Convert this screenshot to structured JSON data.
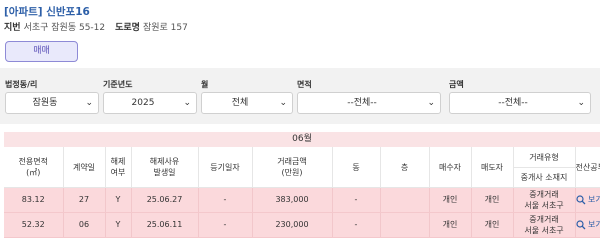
{
  "header": {
    "title": "[아파트] 신반포16",
    "jibun_label": "지번",
    "jibun_value": "서초구 잠원동 55-12",
    "road_label": "도로명",
    "road_value": "잠원로 157"
  },
  "trade_button": "매매",
  "filters": {
    "dong": {
      "label": "법정동/리",
      "value": "잠원동"
    },
    "year": {
      "label": "기준년도",
      "value": "2025"
    },
    "month": {
      "label": "월",
      "value": "전체"
    },
    "area": {
      "label": "면적",
      "value": "--전체--"
    },
    "amount": {
      "label": "금액",
      "value": "--전체--"
    }
  },
  "month_heading": "06월",
  "table": {
    "headers": {
      "area": "전용면적\n(㎡)",
      "contract_day": "계약일",
      "cancel_flag": "해제\n여부",
      "cancel_date": "해제사유\n발생일",
      "register_date": "등기일자",
      "price": "거래금액\n(만원)",
      "building": "동",
      "floor": "층",
      "buyer": "매수자",
      "seller": "매도자",
      "trade_type_top": "거래유형",
      "trade_type_bottom": "중개사 소재지",
      "public_doc": "전산공부"
    },
    "rows": [
      {
        "area": "83.12",
        "contract_day": "27",
        "cancel_flag": "Y",
        "cancel_date": "25.06.27",
        "register_date": "-",
        "price": "383,000",
        "building": "-",
        "floor": "",
        "buyer": "개인",
        "seller": "개인",
        "trade_type": "중개거래",
        "agent_location": "서울 서초구",
        "view_label": "보기"
      },
      {
        "area": "52.32",
        "contract_day": "06",
        "cancel_flag": "Y",
        "cancel_date": "25.06.11",
        "register_date": "-",
        "price": "230,000",
        "building": "-",
        "floor": "",
        "buyer": "개인",
        "seller": "개인",
        "trade_type": "중개거래",
        "agent_location": "서울 서초구",
        "view_label": "보기"
      }
    ]
  }
}
